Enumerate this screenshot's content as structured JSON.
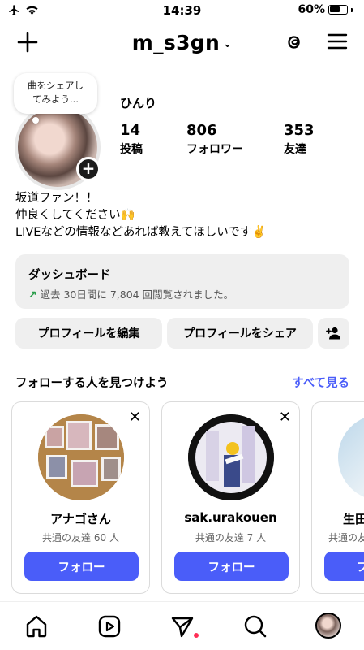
{
  "status_bar": {
    "time": "14:39",
    "battery_text": "60%",
    "icons": [
      "airplane-icon",
      "wifi-icon",
      "battery-icon"
    ]
  },
  "header": {
    "username": "m_s3gn",
    "icons": [
      "plus-icon",
      "chevron-down-icon",
      "threads-icon",
      "hamburger-menu-icon"
    ]
  },
  "profile": {
    "note": [
      "曲をシェアし",
      "てみよう..."
    ],
    "display_name": "ひんり",
    "stats": [
      {
        "num": "14",
        "label": "投稿"
      },
      {
        "num": "806",
        "label": "フォロワー"
      },
      {
        "num": "353",
        "label": "友達"
      }
    ],
    "bio": [
      "坂道ファン！！",
      "仲良くしてください🙌",
      "LIVEなどの情報などあれば教えてほしいです✌️"
    ]
  },
  "dashboard": {
    "title": "ダッシュボード",
    "subtitle": "過去 30日間に 7,804 回閲覧されました。"
  },
  "buttons": {
    "edit_profile": "プロフィールを編集",
    "share_profile": "プロフィールをシェア"
  },
  "suggestions": {
    "title": "フォローする人を見つけよう",
    "see_all": "すべて見る",
    "cards": [
      {
        "name": "アナゴさん",
        "mutual": "共通の友達 60 人",
        "follow": "フォロー"
      },
      {
        "name": "sak.urakouen",
        "mutual": "共通の友達 7 人",
        "follow": "フォロー"
      },
      {
        "name": "生田",
        "mutual": "共通の友",
        "follow": "フ"
      }
    ]
  },
  "bottom_nav": [
    "home-icon",
    "reels-icon",
    "direct-message-icon",
    "search-icon",
    "profile-avatar"
  ],
  "colors": {
    "accent": "#4a5df9",
    "notification_dot": "#ff2e55",
    "trend_green": "#2a9d4a",
    "button_bg": "#efefef"
  }
}
